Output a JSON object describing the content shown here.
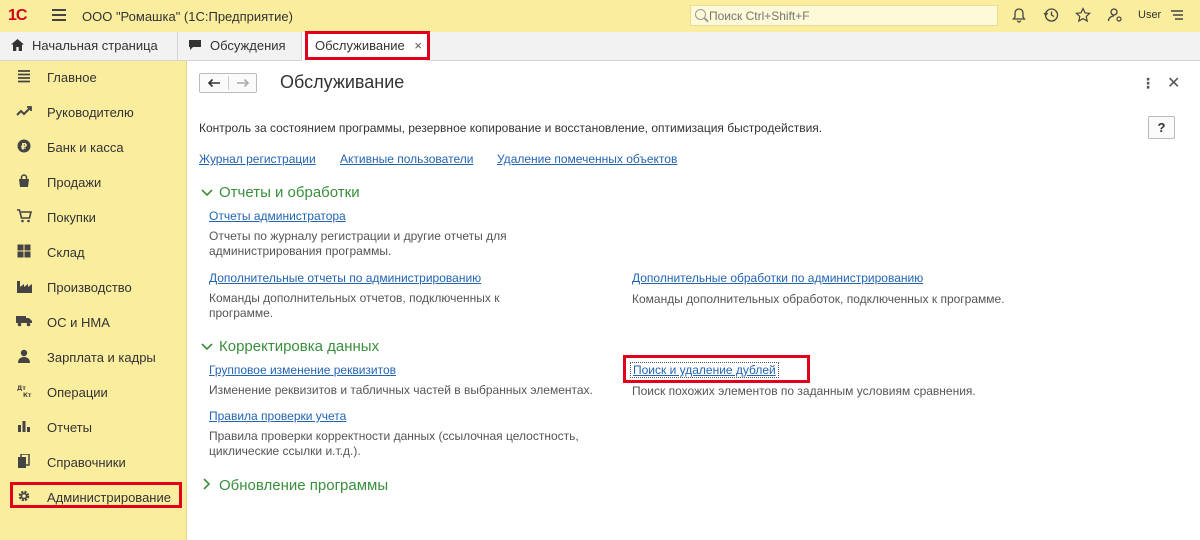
{
  "topbar": {
    "logo": "1С",
    "app_title": "ООО \"Ромашка\"  (1С:Предприятие)",
    "search_placeholder": "Поиск Ctrl+Shift+F",
    "user": "User",
    "icons": [
      "bell-icon",
      "history-icon",
      "star-icon",
      "user-settings-icon",
      "settings-menu-icon"
    ]
  },
  "tabs": [
    {
      "label": "Начальная страница",
      "icon": "home-icon"
    },
    {
      "label": "Обсуждения",
      "icon": "chat-icon"
    },
    {
      "label": "Обслуживание",
      "close": "×",
      "active": true
    }
  ],
  "sidebar": {
    "items": [
      {
        "label": "Главное",
        "icon": "menu-lines-icon"
      },
      {
        "label": "Руководителю",
        "icon": "trend-icon"
      },
      {
        "label": "Банк и касса",
        "icon": "coin-icon"
      },
      {
        "label": "Продажи",
        "icon": "bag-icon"
      },
      {
        "label": "Покупки",
        "icon": "cart-icon"
      },
      {
        "label": "Склад",
        "icon": "warehouse-icon"
      },
      {
        "label": "Производство",
        "icon": "factory-icon"
      },
      {
        "label": "ОС и НМА",
        "icon": "truck-icon"
      },
      {
        "label": "Зарплата и кадры",
        "icon": "person-icon"
      },
      {
        "label": "Операции",
        "icon": "dt-kt-icon"
      },
      {
        "label": "Отчеты",
        "icon": "bar-chart-icon"
      },
      {
        "label": "Справочники",
        "icon": "books-icon"
      },
      {
        "label": "Администрирование",
        "icon": "gear-icon",
        "active": true
      }
    ]
  },
  "main": {
    "title": "Обслуживание",
    "description": "Контроль за состоянием программы, резервное копирование и восстановление, оптимизация быстродействия.",
    "help": "?",
    "top_links": [
      "Журнал регистрации",
      "Активные пользователи",
      "Удаление помеченных объектов"
    ],
    "groups": [
      {
        "title": "Отчеты и обработки",
        "expanded": true,
        "items": [
          {
            "link": "Отчеты администратора",
            "note": "Отчеты по журналу регистрации и другие отчеты для администрирования программы."
          },
          {
            "link": "Дополнительные отчеты по администрированию",
            "note": "Команды дополнительных отчетов, подключенных к программе."
          },
          {
            "link": "Дополнительные обработки по администрированию",
            "note": "Команды дополнительных обработок, подключенных к программе."
          }
        ]
      },
      {
        "title": "Корректировка данных",
        "expanded": true,
        "items": [
          {
            "link": "Групповое изменение реквизитов",
            "note": "Изменение реквизитов и табличных частей в выбранных элементах."
          },
          {
            "link": "Поиск и удаление дублей",
            "note": "Поиск похожих элементов по заданным условиям сравнения."
          },
          {
            "link": "Правила проверки учета",
            "note": "Правила проверки корректности данных (ссылочная целостность, циклические ссылки и.т.д.)."
          }
        ]
      },
      {
        "title": "Обновление программы",
        "expanded": false,
        "items": []
      }
    ]
  },
  "colors": {
    "accent_yellow": "#fbed9e",
    "link": "#2364b3",
    "group_green": "#3a8f3d",
    "highlight_red": "#e0001b"
  }
}
